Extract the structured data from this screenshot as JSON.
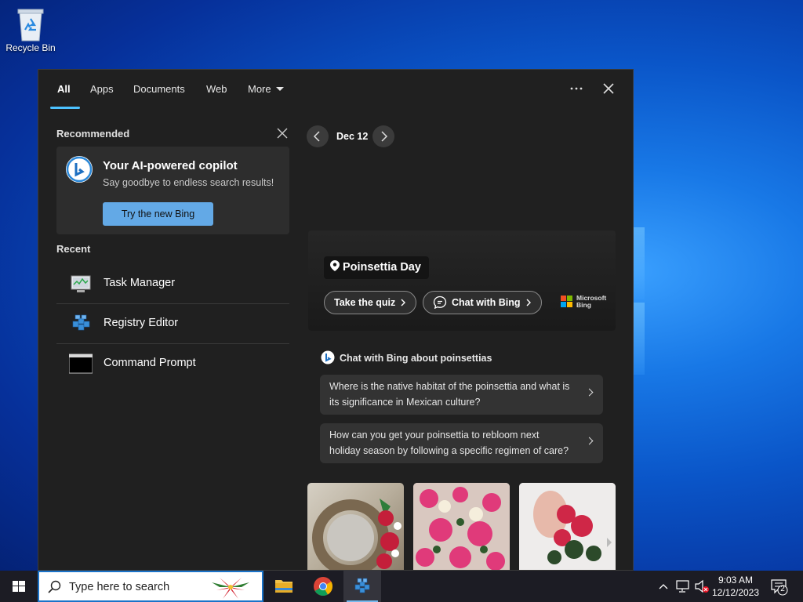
{
  "desktop": {
    "recycle_bin_label": "Recycle Bin"
  },
  "search_panel": {
    "tabs": [
      {
        "label": "All"
      },
      {
        "label": "Apps"
      },
      {
        "label": "Documents"
      },
      {
        "label": "Web"
      },
      {
        "label": "More"
      }
    ],
    "more_options_icon": "ellipsis-icon",
    "close_icon": "close-icon",
    "recommended": {
      "title": "Recommended",
      "card_title": "Your AI-powered copilot",
      "card_subtitle": "Say goodbye to endless search results!",
      "button_label": "Try the new Bing"
    },
    "recent": {
      "title": "Recent",
      "items": [
        {
          "label": "Task Manager",
          "icon": "task-manager-icon"
        },
        {
          "label": "Registry Editor",
          "icon": "registry-editor-icon"
        },
        {
          "label": "Command Prompt",
          "icon": "command-prompt-icon"
        }
      ]
    },
    "highlight": {
      "date": "Dec 12",
      "tag": "Poinsettia Day",
      "quiz_button": "Take the quiz",
      "chat_button": "Chat with Bing",
      "brand_line1": "Microsoft",
      "brand_line2": "Bing"
    },
    "chat": {
      "heading": "Chat with Bing about poinsettias",
      "questions": [
        {
          "text": "Where is the native habitat of the poinsettia and what is its significance in Mexican culture?"
        },
        {
          "text": "How can you get your poinsettia to rebloom next holiday season by following a specific regimen of care?"
        }
      ]
    },
    "colors": {
      "accent": "#4cc2ff",
      "panel_bg": "#202020",
      "button_blue": "#63a9e6"
    }
  },
  "taskbar": {
    "search_placeholder": "Type here to search",
    "apps": [
      {
        "name": "File Explorer",
        "icon": "folder-icon"
      },
      {
        "name": "Google Chrome",
        "icon": "chrome-icon"
      },
      {
        "name": "Registry Editor",
        "icon": "registry-editor-icon"
      }
    ],
    "time": "9:03 AM",
    "date": "12/12/2023",
    "notification_count": "2"
  }
}
